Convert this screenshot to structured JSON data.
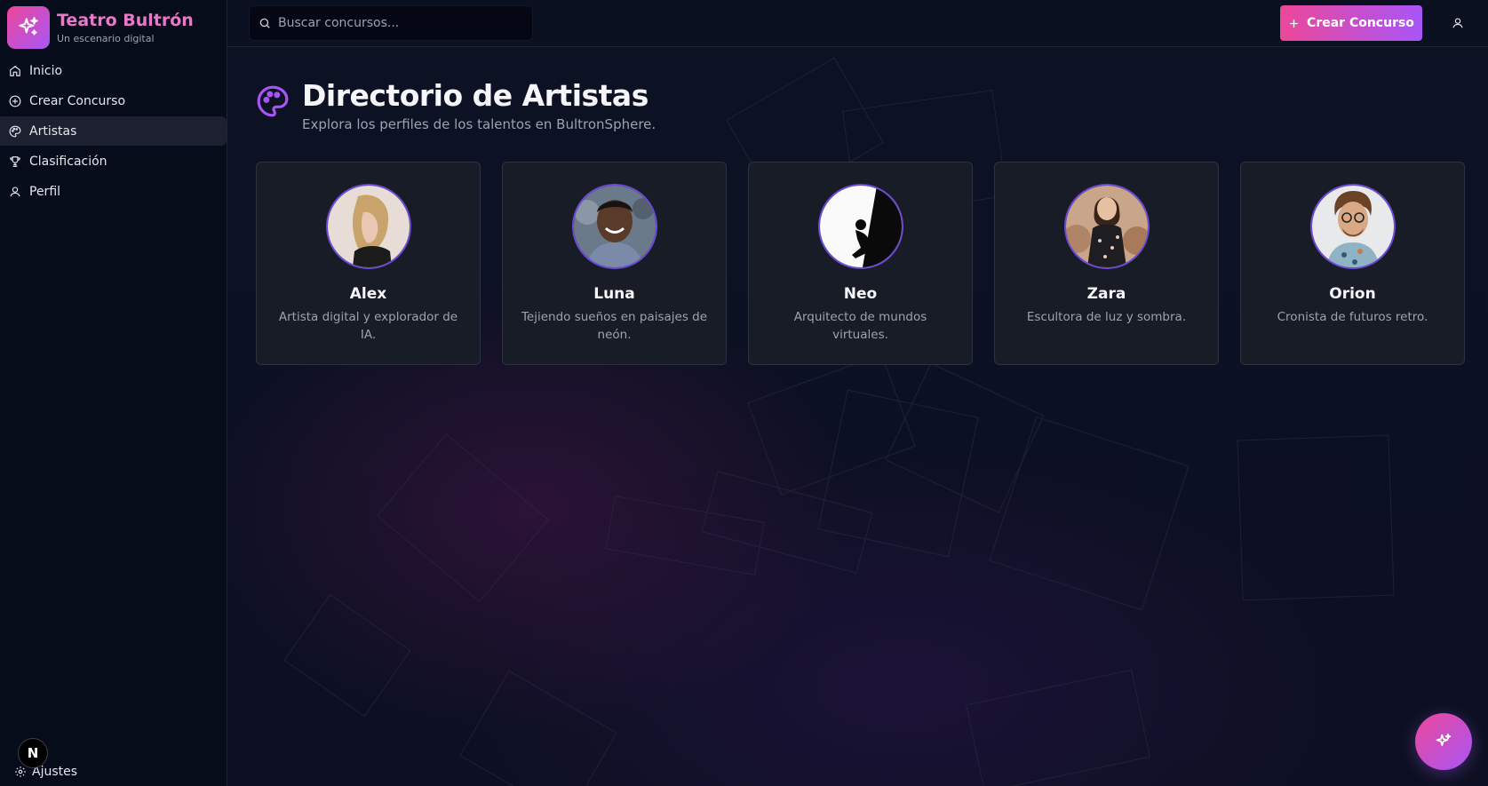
{
  "brand": {
    "title": "Teatro Bultrón",
    "subtitle": "Un escenario digital"
  },
  "sidebar": {
    "items": [
      {
        "label": "Inicio",
        "icon": "home-icon"
      },
      {
        "label": "Crear Concurso",
        "icon": "plus-circle-icon"
      },
      {
        "label": "Artistas",
        "icon": "palette-icon",
        "active": true
      },
      {
        "label": "Clasificación",
        "icon": "trophy-icon"
      },
      {
        "label": "Perfil",
        "icon": "user-icon"
      }
    ],
    "settings_label": "Ajustes",
    "badge_letter": "N"
  },
  "topbar": {
    "search_placeholder": "Buscar concursos...",
    "create_label": "Crear Concurso"
  },
  "page": {
    "title": "Directorio de Artistas",
    "subtitle": "Explora los perfiles de los talentos en BultronSphere."
  },
  "artists": [
    {
      "name": "Alex",
      "bio": "Artista digital y explorador de IA."
    },
    {
      "name": "Luna",
      "bio": "Tejiendo sueños en paisajes de neón."
    },
    {
      "name": "Neo",
      "bio": "Arquitecto de mundos virtuales."
    },
    {
      "name": "Zara",
      "bio": "Escultora de luz y sombra."
    },
    {
      "name": "Orion",
      "bio": "Cronista de futuros retro."
    }
  ],
  "colors": {
    "accent_start": "#ec4899",
    "accent_end": "#a855f7",
    "avatar_ring": "#6d4ad6"
  }
}
